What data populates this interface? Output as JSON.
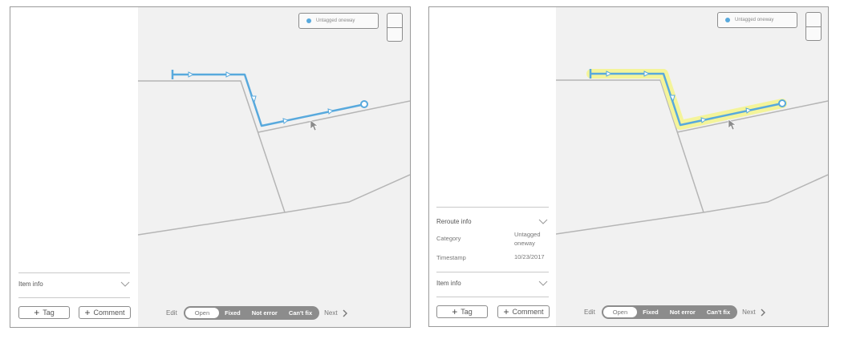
{
  "legend": {
    "label": "Untagged oneway",
    "dot_color": "#58a9dd"
  },
  "left_frame": {
    "item_info": {
      "title": "Item info",
      "chevron_icon": "chevron-down-icon"
    },
    "buttons": {
      "tag": "Tag",
      "comment": "Comment",
      "icon": "plus-icon"
    }
  },
  "right_frame": {
    "reroute_info": {
      "title": "Reroute info",
      "category_label": "Category",
      "category_value_line1": "Untagged",
      "category_value_line2": "oneway",
      "timestamp_label": "Timestamp",
      "timestamp_value": "10/23/2017"
    },
    "item_info": {
      "title": "Item info"
    },
    "buttons": {
      "tag": "Tag",
      "comment": "Comment"
    }
  },
  "action_bar": {
    "edit": "Edit",
    "statuses": [
      "Open",
      "Fixed",
      "Not error",
      "Can't fix"
    ],
    "selected_status": "Open",
    "next": "Next"
  },
  "colors": {
    "route": "#58a9dd",
    "highlight": "#f4f49a",
    "road": "#b5b5b5"
  }
}
